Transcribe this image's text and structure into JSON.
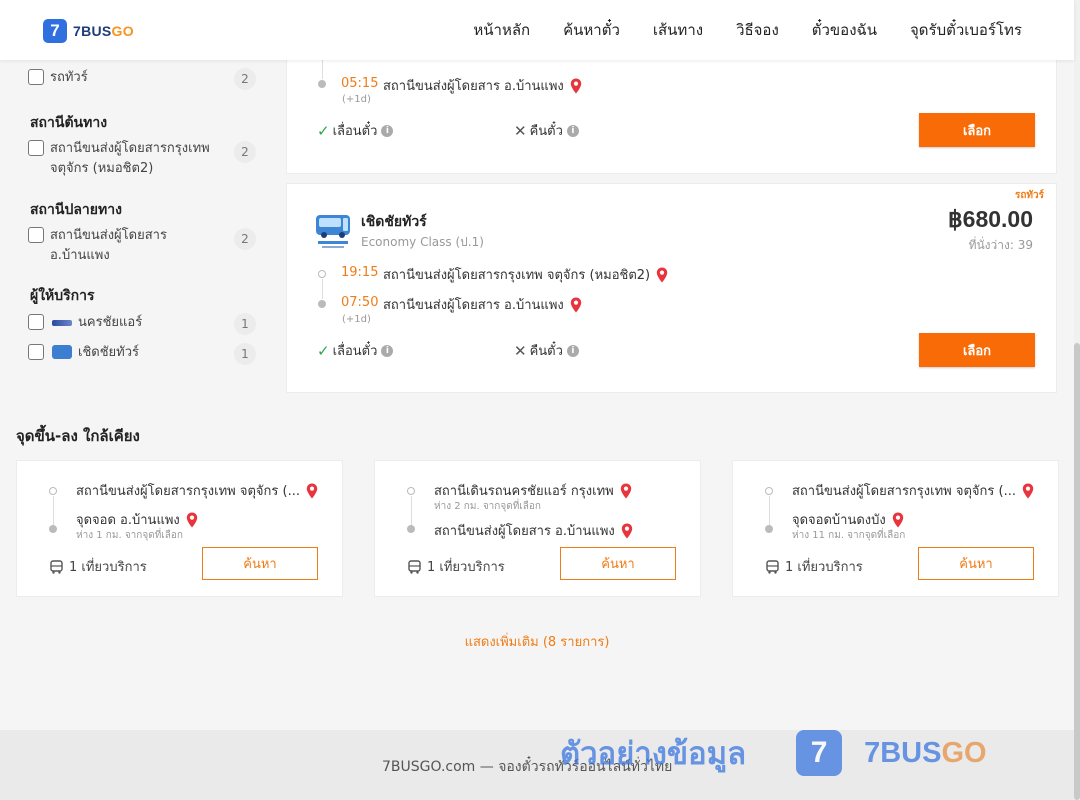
{
  "header": {
    "logo_text_main": "7BUS",
    "logo_text_accent": "GO",
    "logo_badge": "7",
    "nav": [
      "หน้าหลัก",
      "ค้นหาตั๋ว",
      "เส้นทาง",
      "วิธีจอง",
      "ตั๋วของฉัน",
      "จุดรับตั๋วเบอร์โทร"
    ]
  },
  "sidebar": {
    "vehicle_type": {
      "label": "รถทัวร์",
      "count": "2"
    },
    "origin": {
      "title": "สถานีต้นทาง",
      "label": "สถานีขนส่งผู้โดยสารกรุงเทพ จตุจักร (หมอชิต2)",
      "count": "2"
    },
    "destination": {
      "title": "สถานีปลายทาง",
      "label": "สถานีขนส่งผู้โดยสาร อ.บ้านแพง",
      "count": "2"
    },
    "operators": {
      "title": "ผู้ให้บริการ",
      "items": [
        {
          "label": "นครชัยแอร์",
          "count": "1"
        },
        {
          "label": "เชิดชัยทัวร์",
          "count": "1"
        }
      ]
    }
  },
  "results": [
    {
      "arrive_time": "05:15",
      "arrive_station": "สถานีขนส่งผู้โดยสาร อ.บ้านแพง",
      "next_day": "(+1d)",
      "postpone": "เลื่อนตั๋ว",
      "refund": "คืนตั๋ว",
      "select": "เลือก"
    },
    {
      "tag": "รถทัวร์",
      "operator": "เชิดชัยทัวร์",
      "class": "Economy Class (ป.1)",
      "price": "฿680.00",
      "seats": "ที่นั่งว่าง: 39",
      "depart_time": "19:15",
      "depart_station": "สถานีขนส่งผู้โดยสารกรุงเทพ จตุจักร (หมอชิต2)",
      "arrive_time": "07:50",
      "arrive_station": "สถานีขนส่งผู้โดยสาร อ.บ้านแพง",
      "next_day": "(+1d)",
      "postpone": "เลื่อนตั๋ว",
      "refund": "คืนตั๋ว",
      "select": "เลือก"
    }
  ],
  "nearby": {
    "title": "จุดขึ้น-ลง ใกล้เคียง",
    "cards": [
      {
        "from": "สถานีขนส่งผู้โดยสารกรุงเทพ จตุจักร (...",
        "from_dist": "",
        "to": "จุดจอด อ.บ้านแพง",
        "to_dist": "ห่าง 1 กม. จากจุดที่เลือก",
        "trips": "1 เที่ยวบริการ",
        "button": "ค้นหา"
      },
      {
        "from": "สถานีเดินรถนครชัยแอร์ กรุงเทพ",
        "from_dist": "ห่าง 2 กม. จากจุดที่เลือก",
        "to": "สถานีขนส่งผู้โดยสาร อ.บ้านแพง",
        "to_dist": "",
        "trips": "1 เที่ยวบริการ",
        "button": "ค้นหา"
      },
      {
        "from": "สถานีขนส่งผู้โดยสารกรุงเทพ จตุจักร (...",
        "from_dist": "",
        "to": "จุดจอดบ้านดงบัง",
        "to_dist": "ห่าง 11 กม. จากจุดที่เลือก",
        "trips": "1 เที่ยวบริการ",
        "button": "ค้นหา"
      }
    ],
    "show_more": "แสดงเพิ่มเติม (8 รายการ)"
  },
  "footer": {
    "text": "7BUSGO.com — จองตั๋วรถทัวร์ออนไลน์ทั่วไทย"
  },
  "watermark": {
    "caption": "ตัวอย่างข้อมูล",
    "badge": "7",
    "brand_main": "7BUS",
    "brand_accent": "GO"
  },
  "colors": {
    "accent": "#f96b06",
    "brand_blue": "#2f6fe0",
    "time_orange": "#f07c16"
  }
}
